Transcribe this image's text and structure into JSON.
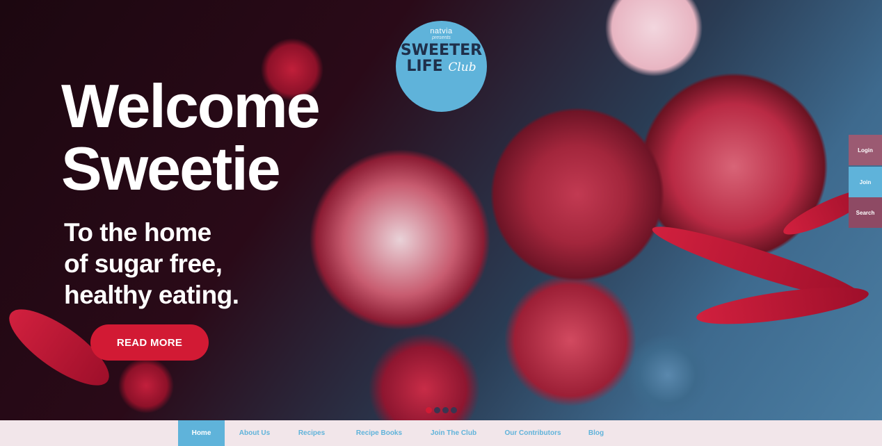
{
  "logo": {
    "brand": "natvia",
    "presents": "presents",
    "line1": "SWEETER",
    "line2": "LIFE",
    "club": "Club"
  },
  "hero": {
    "headline_line1": "Welcome",
    "headline_line2": "Sweetie",
    "sub_line1": "To the home",
    "sub_line2": "of sugar free,",
    "sub_line3": "healthy eating.",
    "cta_label": "READ MORE"
  },
  "side_tabs": {
    "login": "Login",
    "join": "Join",
    "search": "Search"
  },
  "slider": {
    "slide_count": 4,
    "active_index": 0
  },
  "nav": {
    "items": [
      {
        "label": "Home",
        "active": true
      },
      {
        "label": "About Us",
        "active": false
      },
      {
        "label": "Recipes",
        "active": false
      },
      {
        "label": "Recipe Books",
        "active": false
      },
      {
        "label": "Join The Club",
        "active": false
      },
      {
        "label": "Our Contributors",
        "active": false
      },
      {
        "label": "Blog",
        "active": false
      }
    ]
  },
  "colors": {
    "accent_red": "#d21a34",
    "accent_blue": "#5fb3da",
    "nav_background": "#f2e6ea"
  }
}
